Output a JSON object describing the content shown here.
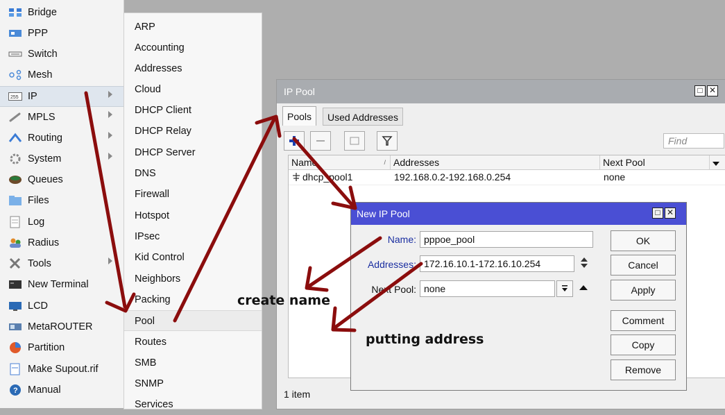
{
  "sidebar": {
    "items": [
      {
        "label": "Bridge",
        "icon": "bridge-icon"
      },
      {
        "label": "PPP",
        "icon": "ppp-icon"
      },
      {
        "label": "Switch",
        "icon": "switch-icon"
      },
      {
        "label": "Mesh",
        "icon": "mesh-icon"
      },
      {
        "label": "IP",
        "icon": "ip-icon",
        "submenu": true
      },
      {
        "label": "MPLS",
        "icon": "mpls-icon",
        "submenu": true
      },
      {
        "label": "Routing",
        "icon": "routing-icon",
        "submenu": true
      },
      {
        "label": "System",
        "icon": "system-icon",
        "submenu": true
      },
      {
        "label": "Queues",
        "icon": "queues-icon"
      },
      {
        "label": "Files",
        "icon": "files-icon"
      },
      {
        "label": "Log",
        "icon": "log-icon"
      },
      {
        "label": "Radius",
        "icon": "radius-icon"
      },
      {
        "label": "Tools",
        "icon": "tools-icon",
        "submenu": true
      },
      {
        "label": "New Terminal",
        "icon": "terminal-icon"
      },
      {
        "label": "LCD",
        "icon": "lcd-icon"
      },
      {
        "label": "MetaROUTER",
        "icon": "metarouter-icon"
      },
      {
        "label": "Partition",
        "icon": "partition-icon"
      },
      {
        "label": "Make Supout.rif",
        "icon": "supout-icon"
      },
      {
        "label": "Manual",
        "icon": "manual-icon"
      }
    ]
  },
  "submenu": {
    "items": [
      "ARP",
      "Accounting",
      "Addresses",
      "Cloud",
      "DHCP Client",
      "DHCP Relay",
      "DHCP Server",
      "DNS",
      "Firewall",
      "Hotspot",
      "IPsec",
      "Kid Control",
      "Neighbors",
      "Packing",
      "Pool",
      "Routes",
      "SMB",
      "SNMP",
      "Services"
    ]
  },
  "ip_pool": {
    "title": "IP Pool",
    "tabs": [
      "Pools",
      "Used Addresses"
    ],
    "find_placeholder": "Find",
    "columns": [
      "Name",
      "Addresses",
      "Next Pool"
    ],
    "rows": [
      {
        "name": "dhcp_pool1",
        "addresses": "192.168.0.2-192.168.0.254",
        "next_pool": "none"
      }
    ],
    "status": "1 item"
  },
  "new_pool": {
    "title": "New IP Pool",
    "name_label": "Name:",
    "name_value": "pppoe_pool",
    "addresses_label": "Addresses:",
    "addresses_value": "172.16.10.1-172.16.10.254",
    "next_pool_label": "Next Pool:",
    "next_pool_value": "none",
    "buttons": [
      "OK",
      "Cancel",
      "Apply",
      "Comment",
      "Copy",
      "Remove"
    ]
  },
  "annotations": {
    "create_name": "create name",
    "putting_address": "putting address"
  },
  "colors": {
    "arrow": "#8b0d0d",
    "dialog_title": "#4a4fd4",
    "pool_title": "#a9acb0"
  }
}
